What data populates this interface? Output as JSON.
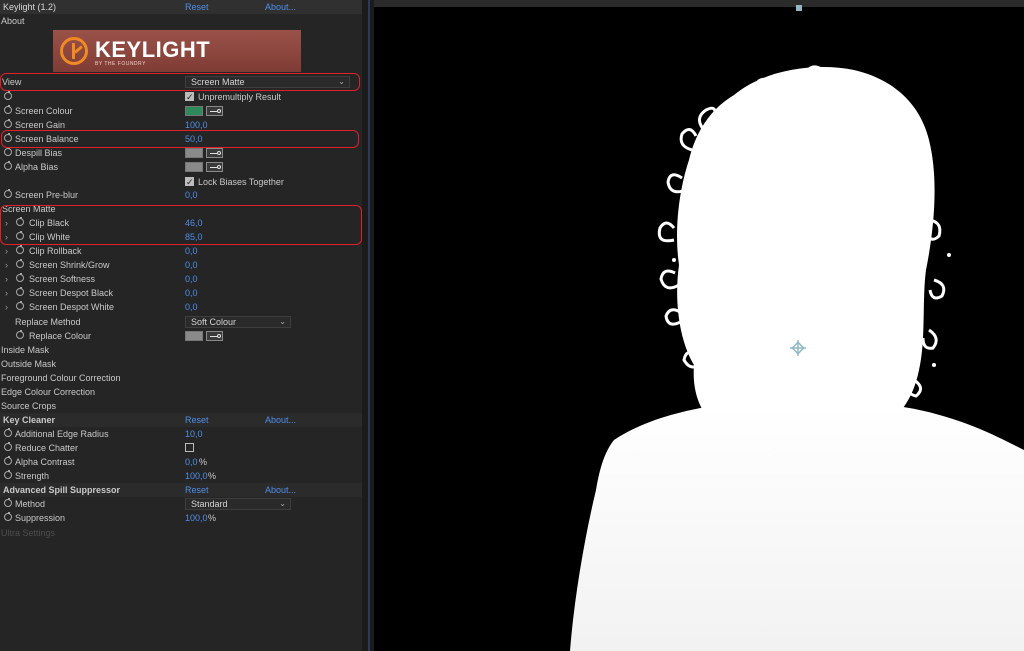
{
  "header": {
    "title": "Keylight (1.2)",
    "reset": "Reset",
    "about": "About..."
  },
  "about_label": "About",
  "logo": {
    "name": "KEYLIGHT",
    "sub": "BY THE FOUNDRY"
  },
  "view": {
    "label": "View",
    "value": "Screen Matte"
  },
  "unpremultiply": {
    "label": "Unpremultiply Result",
    "checked": true
  },
  "screen_colour": {
    "label": "Screen Colour",
    "color": "#2e8a5a"
  },
  "screen_gain": {
    "label": "Screen Gain",
    "value": "100,0"
  },
  "screen_balance": {
    "label": "Screen Balance",
    "value": "50,0"
  },
  "despill_bias": {
    "label": "Despill Bias",
    "color": "#8a8a8a"
  },
  "alpha_bias": {
    "label": "Alpha Bias",
    "color": "#8a8a8a"
  },
  "lock_biases": {
    "label": "Lock Biases Together",
    "checked": true
  },
  "screen_preblur": {
    "label": "Screen Pre-blur",
    "value": "0,0"
  },
  "screen_matte": {
    "label": "Screen Matte",
    "items": [
      {
        "label": "Clip Black",
        "value": "46,0"
      },
      {
        "label": "Clip White",
        "value": "85,0"
      },
      {
        "label": "Clip Rollback",
        "value": "0,0"
      },
      {
        "label": "Screen Shrink/Grow",
        "value": "0,0"
      },
      {
        "label": "Screen Softness",
        "value": "0,0"
      },
      {
        "label": "Screen Despot Black",
        "value": "0,0"
      },
      {
        "label": "Screen Despot White",
        "value": "0,0"
      }
    ],
    "replace_method": {
      "label": "Replace Method",
      "value": "Soft Colour"
    },
    "replace_colour": {
      "label": "Replace Colour",
      "color": "#8a8a8a"
    }
  },
  "groups": [
    "Inside Mask",
    "Outside Mask",
    "Foreground Colour Correction",
    "Edge Colour Correction",
    "Source Crops"
  ],
  "key_cleaner": {
    "title": "Key Cleaner",
    "reset": "Reset",
    "about": "About...",
    "edge_radius": {
      "label": "Additional Edge Radius",
      "value": "10,0"
    },
    "reduce_chatter": {
      "label": "Reduce Chatter",
      "checked": false
    },
    "alpha_contrast": {
      "label": "Alpha Contrast",
      "value": "0,0",
      "unit": "%"
    },
    "strength": {
      "label": "Strength",
      "value": "100,0",
      "unit": "%"
    }
  },
  "spill": {
    "title": "Advanced Spill Suppressor",
    "reset": "Reset",
    "about": "About...",
    "method": {
      "label": "Method",
      "value": "Standard"
    },
    "suppression": {
      "label": "Suppression",
      "value": "100,0",
      "unit": "%"
    }
  },
  "ultra_settings": "Ultra Settings",
  "highlight_color": "#e0202a",
  "value_color": "#4f8ee8"
}
